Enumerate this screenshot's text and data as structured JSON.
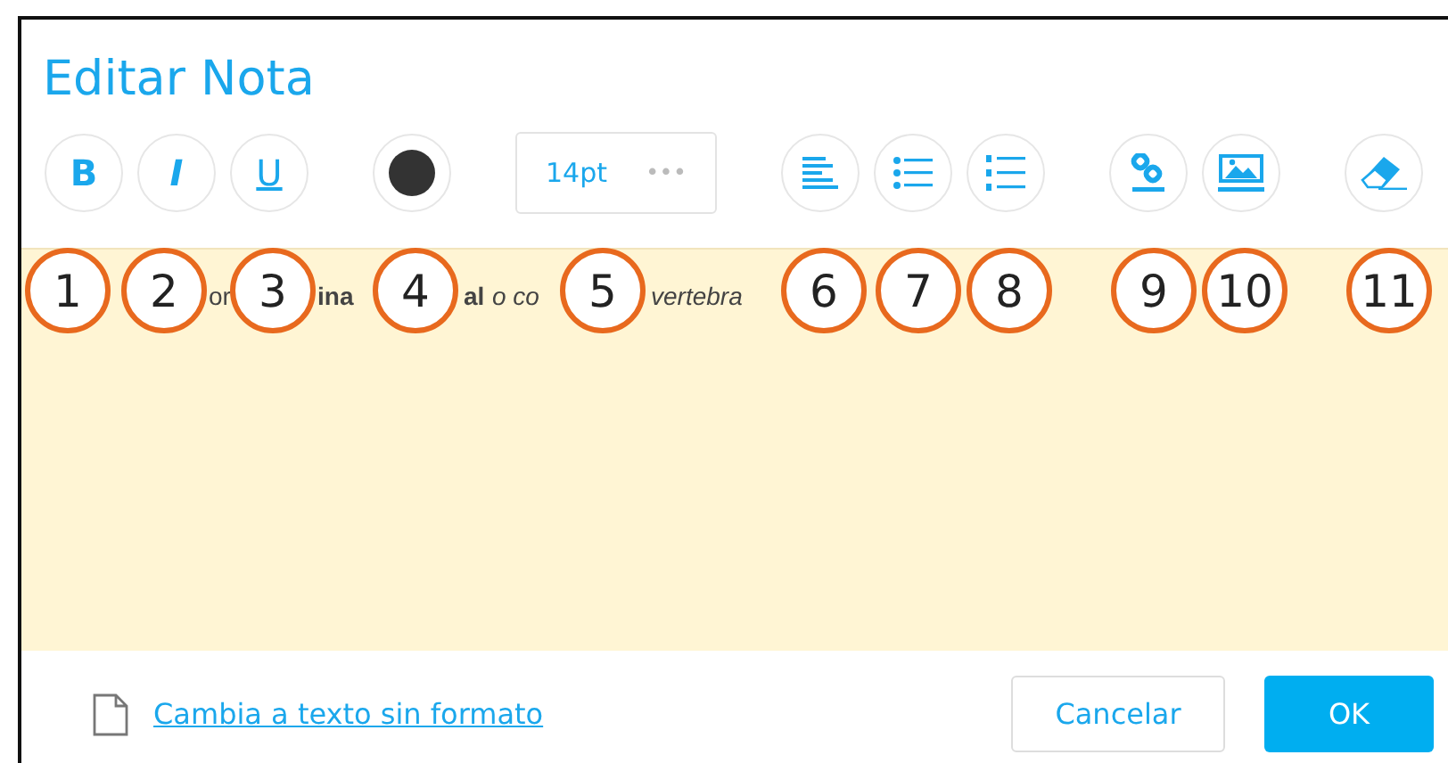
{
  "dialog": {
    "title": "Editar Nota"
  },
  "toolbar": {
    "groups": [
      [
        {
          "kind": "bold",
          "label": "B"
        },
        {
          "kind": "italic",
          "label": "I"
        },
        {
          "kind": "underline",
          "label": "U"
        }
      ],
      [
        {
          "kind": "color",
          "color": "#333333"
        }
      ],
      [
        {
          "kind": "size",
          "label": "14pt",
          "more": "•••"
        }
      ],
      [
        {
          "kind": "align"
        },
        {
          "kind": "bullets"
        },
        {
          "kind": "numbers"
        }
      ],
      [
        {
          "kind": "link"
        },
        {
          "kind": "image"
        }
      ],
      [
        {
          "kind": "eraser"
        }
      ]
    ]
  },
  "editor": {
    "fragments": [
      {
        "text": "or",
        "kind": "plain"
      },
      {
        "text": "ina",
        "kind": "bold"
      },
      {
        "text": "al",
        "kind": "bold"
      },
      {
        "text": "o co",
        "kind": "italic"
      },
      {
        "text": "vertebra",
        "kind": "italic"
      }
    ]
  },
  "callouts": [
    "1",
    "2",
    "3",
    "4",
    "5",
    "6",
    "7",
    "8",
    "9",
    "10",
    "11"
  ],
  "footer": {
    "link": "Cambia a texto sin formato",
    "buttons": [
      {
        "label": "Cancelar",
        "kind": "secondary"
      },
      {
        "label": "OK",
        "kind": "primary"
      }
    ]
  }
}
